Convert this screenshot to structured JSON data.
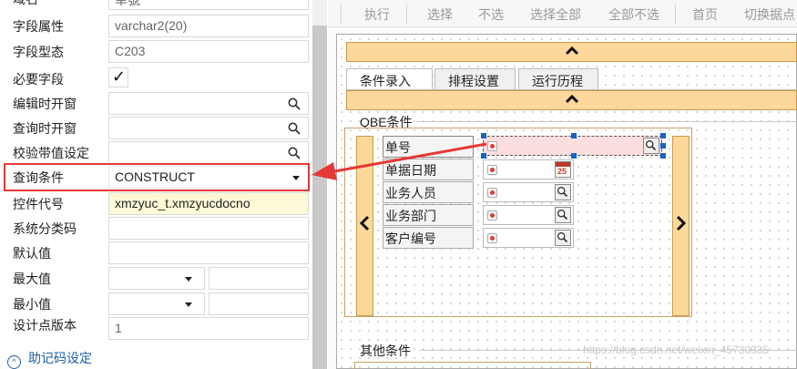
{
  "property_panel": {
    "partial_row": {
      "label": "域名",
      "value": "单號"
    },
    "rows": [
      {
        "label": "字段属性",
        "value": "varchar2(20)"
      },
      {
        "label": "字段型态",
        "value": "C203"
      },
      {
        "label": "必要字段",
        "checked": true,
        "check_glyph": "✓"
      },
      {
        "label": "编辑时开窗",
        "value": "",
        "icon": "search-icon"
      },
      {
        "label": "查询时开窗",
        "value": "",
        "icon": "search-icon"
      },
      {
        "label": "校验带值设定",
        "value": "",
        "icon": "search-icon"
      },
      {
        "label": "查询条件",
        "value": "CONSTRUCT",
        "icon": "dropdown-arrow"
      },
      {
        "label": "控件代号",
        "value": "xmzyuc_t.xmzyucdocno"
      },
      {
        "label": "系统分类码",
        "value": ""
      },
      {
        "label": "默认值",
        "value": ""
      },
      {
        "label": "最大值",
        "value": "",
        "value2": ""
      },
      {
        "label": "最小值",
        "value": "",
        "value2": ""
      },
      {
        "label": "设计点版本",
        "value": "1"
      }
    ],
    "mnemonic_link": "助记码设定",
    "mnemonic_glyph": "^"
  },
  "toolbar": {
    "buttons": [
      "执行",
      "选择",
      "不选",
      "选择全部",
      "全部不选",
      "首页",
      "切换据点"
    ]
  },
  "designer": {
    "tabs": [
      "条件录入",
      "排程设置",
      "运行历程"
    ],
    "active_tab": 0,
    "qbe_group_title": "QBE条件",
    "other_group_title": "其他条件",
    "qbe_fields": [
      {
        "label": "单号",
        "button": "lookup",
        "selected": true
      },
      {
        "label": "单据日期",
        "button": "calendar",
        "calendar_day": "25"
      },
      {
        "label": "业务人员",
        "button": "lookup"
      },
      {
        "label": "业务部门",
        "button": "lookup"
      },
      {
        "label": "客户编号",
        "button": "lookup"
      }
    ],
    "watermark": "https://blog.csdn.net/weixin_45730335"
  },
  "colors": {
    "highlight_border": "#e53935",
    "arrow": "#e53935",
    "band_fill": "#fcd89a",
    "selection_handle": "#1565c0",
    "input_highlight": "#fdf8d6",
    "link": "#1f5f9f"
  }
}
